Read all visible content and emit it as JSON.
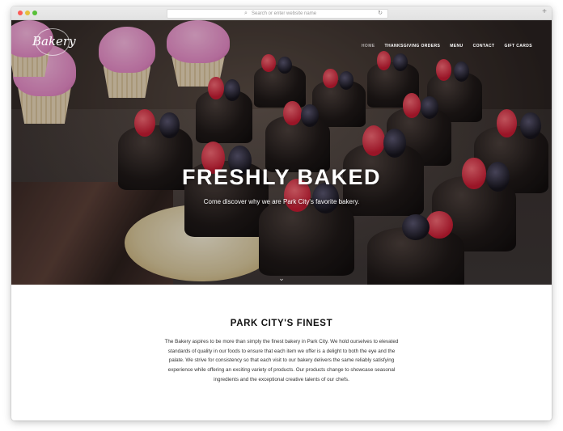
{
  "browser": {
    "url_placeholder": "Search or enter website name",
    "search_glyph": "⌕",
    "reload_glyph": "↻",
    "new_tab_glyph": "+"
  },
  "site": {
    "logo_text": "Bakery",
    "nav": [
      {
        "label": "Home",
        "active": true
      },
      {
        "label": "Thanksgiving Orders",
        "active": false
      },
      {
        "label": "Menu",
        "active": false
      },
      {
        "label": "Contact",
        "active": false
      },
      {
        "label": "Gift Cards",
        "active": false
      }
    ]
  },
  "hero": {
    "title": "FRESHLY BAKED",
    "subtitle": "Come discover why we are Park City's favorite bakery.",
    "scroll_glyph": "⌄"
  },
  "section": {
    "title": "PARK CITY'S FINEST",
    "body": "The Bakery aspires to be more than simply the finest bakery in Park City. We hold ourselves to elevated standards of quality in our foods to ensure that each item we offer is a delight to both the eye and the palate. We strive for consistency so that each visit to our bakery delivers the same reliably satisfying experience while offering an exciting variety of products. Our products change to showcase seasonal ingredients and the exceptional creative talents of our chefs."
  },
  "colors": {
    "frosting_pink": "#e48ac5",
    "chocolate": "#1f1918",
    "raspberry": "#c51b32",
    "blackberry": "#16141c"
  }
}
